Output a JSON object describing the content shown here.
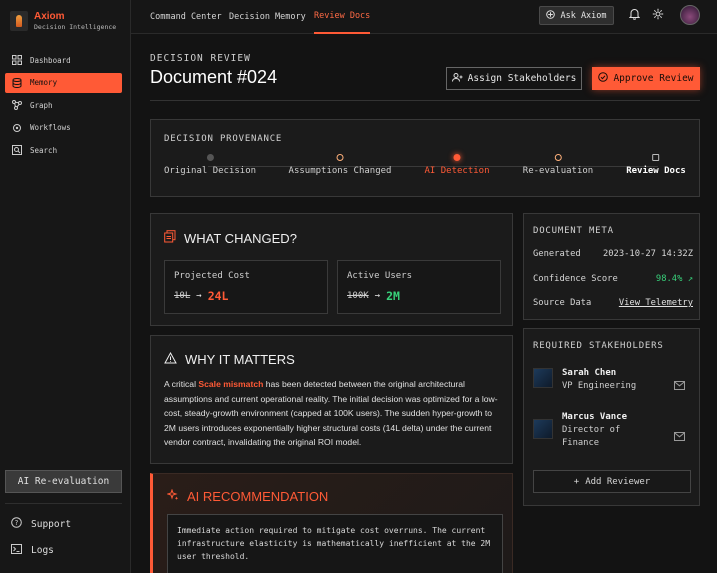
{
  "brand": {
    "name": "Axiom",
    "subtitle": "Decision Intelligence"
  },
  "sidebar": {
    "items": [
      {
        "label": "Dashboard",
        "icon": "dashboard-icon",
        "active": false
      },
      {
        "label": "Memory",
        "icon": "database-icon",
        "active": true
      },
      {
        "label": "Graph",
        "icon": "graph-icon",
        "active": false
      },
      {
        "label": "Workflows",
        "icon": "workflow-icon",
        "active": false
      },
      {
        "label": "Search",
        "icon": "search-icon",
        "active": false
      }
    ],
    "reevaluate_label": "AI Re-evaluation",
    "support_label": "Support",
    "logs_label": "Logs"
  },
  "topbar": {
    "tabs": [
      {
        "label": "Command Center",
        "active": false
      },
      {
        "label": "Decision Memory",
        "active": false
      },
      {
        "label": "Review Docs",
        "active": true
      }
    ],
    "ask_label": "Ask Axiom"
  },
  "header": {
    "kicker": "DECISION REVIEW",
    "title": "Document #024",
    "assign_label": "Assign Stakeholders",
    "approve_label": "Approve Review"
  },
  "provenance": {
    "label": "DECISION PROVENANCE",
    "steps": [
      {
        "label": "Original Decision",
        "state": "done"
      },
      {
        "label": "Assumptions Changed",
        "state": "outline"
      },
      {
        "label": "AI Detection",
        "state": "active"
      },
      {
        "label": "Re-evaluation",
        "state": "outline"
      },
      {
        "label": "Review Docs",
        "state": "current"
      }
    ]
  },
  "what_changed": {
    "title": "WHAT CHANGED?",
    "metrics": [
      {
        "label": "Projected Cost",
        "old": "10L",
        "new": "24L",
        "trend": "bad"
      },
      {
        "label": "Active Users",
        "old": "100K",
        "new": "2M",
        "trend": "good"
      }
    ]
  },
  "why_matters": {
    "title": "WHY IT MATTERS",
    "pre": "A critical ",
    "highlight": "Scale mismatch",
    "post": " has been detected between the original architectural assumptions and current operational reality. The initial decision was optimized for a low-cost, steady-growth environment (capped at 100K users). The sudden hyper-growth to 2M users introduces exponentially higher structural costs (14L delta) under the current vendor contract, invalidating the original ROI model."
  },
  "recommendation": {
    "title": "AI RECOMMENDATION",
    "text": "Immediate action required to mitigate cost overruns. The current infrastructure elasticity is mathematically inefficient at the 2M user threshold."
  },
  "meta": {
    "label": "DOCUMENT META",
    "generated_label": "Generated",
    "generated_value": "2023-10-27 14:32Z",
    "confidence_label": "Confidence Score",
    "confidence_value": "98.4%",
    "source_label": "Source Data",
    "source_value": "View Telemetry"
  },
  "stakeholders": {
    "label": "REQUIRED STAKEHOLDERS",
    "people": [
      {
        "name": "Sarah Chen",
        "role": "VP Engineering"
      },
      {
        "name": "Marcus Vance",
        "role": "Director of Finance"
      }
    ],
    "add_label": "Add Reviewer"
  },
  "colors": {
    "accent": "#ff5a36",
    "success": "#38d07a",
    "background": "#131313",
    "card": "#1b1b1b"
  }
}
